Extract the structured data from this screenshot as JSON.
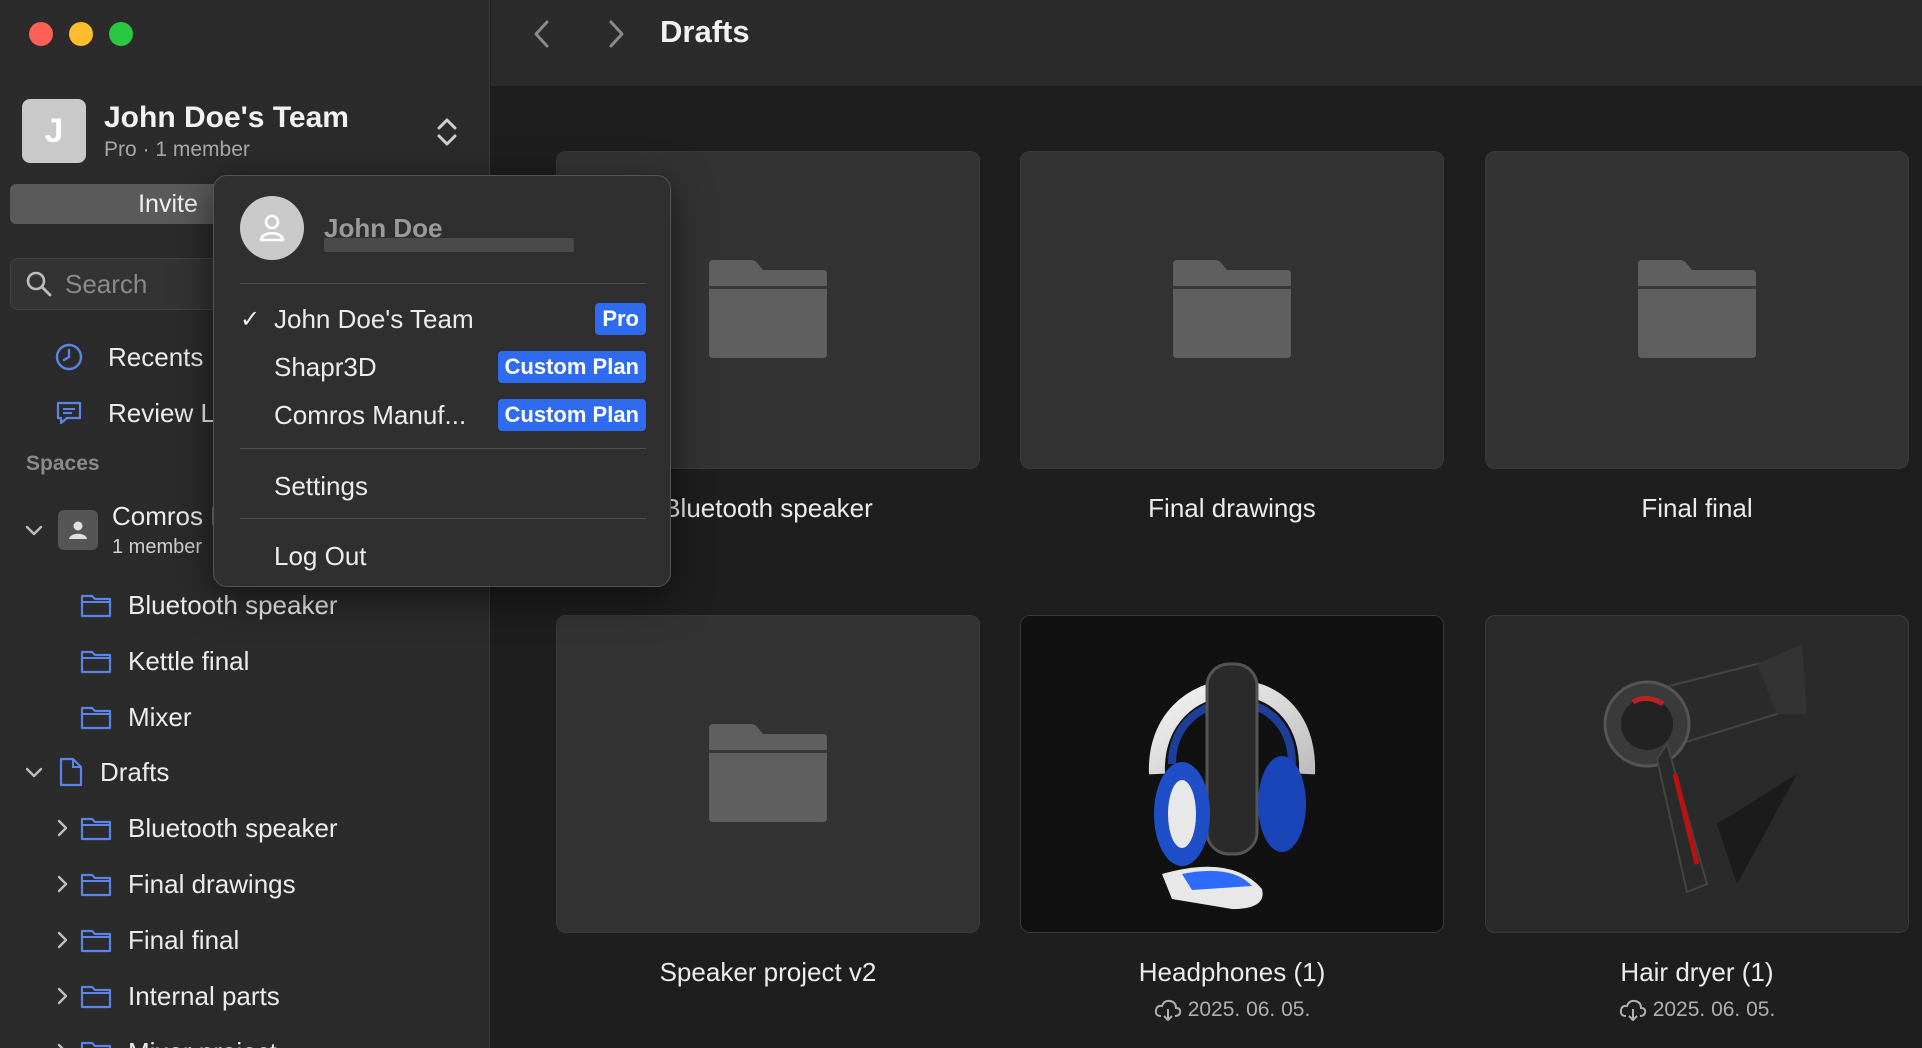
{
  "window": {
    "title": "Drafts"
  },
  "sidebar": {
    "team": {
      "initial": "J",
      "name": "John Doe's Team",
      "plan": "Pro · 1 member"
    },
    "invite_label": "Invite",
    "search_placeholder": "Search",
    "nav": [
      {
        "label": "Recents"
      },
      {
        "label": "Review L"
      }
    ],
    "spaces_heading": "Spaces",
    "space": {
      "name": "Comros I",
      "sub": "1 member"
    },
    "space_folders": [
      {
        "label": "Bluetooth speaker"
      },
      {
        "label": "Kettle final"
      },
      {
        "label": "Mixer"
      }
    ],
    "drafts_label": "Drafts",
    "draft_folders": [
      {
        "label": "Bluetooth speaker"
      },
      {
        "label": "Final drawings"
      },
      {
        "label": "Final final"
      },
      {
        "label": "Internal parts"
      },
      {
        "label": "Mixer project"
      }
    ]
  },
  "dropdown": {
    "user_name": "John Doe",
    "teams": [
      {
        "label": "John Doe's Team",
        "badge": "Pro",
        "checked": true
      },
      {
        "label": "Shapr3D",
        "badge": "Custom Plan",
        "checked": false
      },
      {
        "label": "Comros Manuf...",
        "badge": "Custom Plan",
        "checked": false
      }
    ],
    "settings_label": "Settings",
    "logout_label": "Log Out",
    "check_glyph": "✓"
  },
  "grid": {
    "items": [
      {
        "title": "Bluetooth speaker",
        "kind": "folder"
      },
      {
        "title": "Final drawings",
        "kind": "folder"
      },
      {
        "title": "Final final",
        "kind": "folder"
      },
      {
        "title": "Speaker project v2",
        "kind": "folder"
      },
      {
        "title": "Headphones (1)",
        "kind": "model",
        "date": "2025. 06. 05."
      },
      {
        "title": "Hair dryer (1)",
        "kind": "model",
        "date": "2025. 06. 05."
      }
    ]
  },
  "colors": {
    "accent": "#2f6bf0",
    "folder_icon": "#5b84e8"
  }
}
